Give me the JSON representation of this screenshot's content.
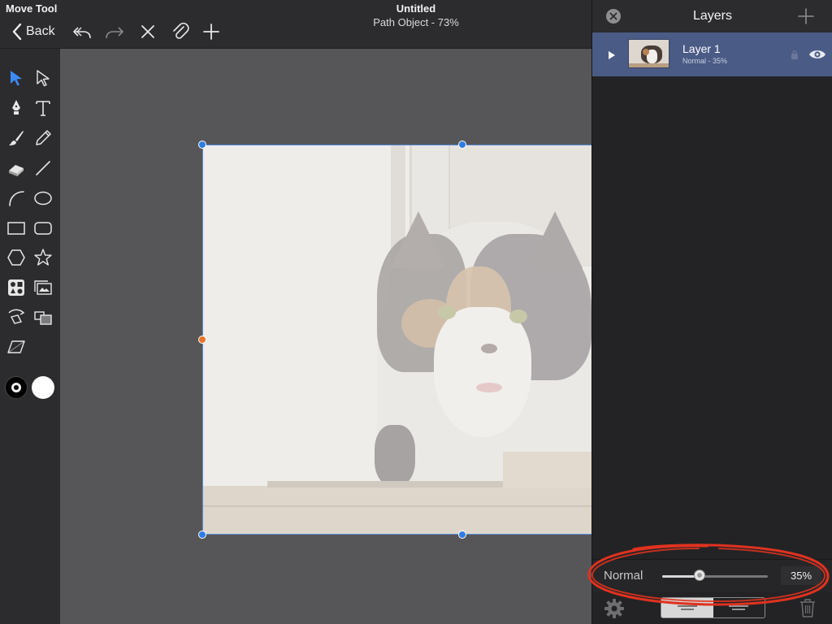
{
  "topbar": {
    "tool_name": "Move Tool",
    "back_label": "Back",
    "doc_title": "Untitled",
    "doc_subtitle": "Path Object - 73%",
    "icons": [
      "undo-icon",
      "redo-icon",
      "close-icon",
      "attach-icon",
      "add-icon"
    ]
  },
  "toolbar": {
    "tools": [
      "select-icon",
      "direct-select-icon",
      "pen-icon",
      "text-icon",
      "brush-icon",
      "pencil-icon",
      "eraser-icon",
      "line-icon",
      "arc-icon",
      "ellipse-icon",
      "rectangle-icon",
      "rounded-rectangle-icon",
      "hexagon-icon",
      "star-icon",
      "shapes-icon",
      "image-stack-icon",
      "transform-icon",
      "arrange-icon",
      "skew-icon"
    ],
    "stroke_color": "#000000",
    "fill_color": "#ffffff",
    "active_tool": "select-icon",
    "active_color": "#3d8af7"
  },
  "canvas": {
    "object": "cat photo (image placeholder)",
    "selection_color": "#2f7de1",
    "handle_accent": "#e8742a"
  },
  "layers": {
    "title": "Layers",
    "items": [
      {
        "name": "Layer 1",
        "meta": "Normal - 35%",
        "selected": true
      }
    ],
    "blend_mode": "Normal",
    "opacity": 35,
    "opacity_label": "35%"
  },
  "annotation": {
    "color": "#e0321f"
  }
}
